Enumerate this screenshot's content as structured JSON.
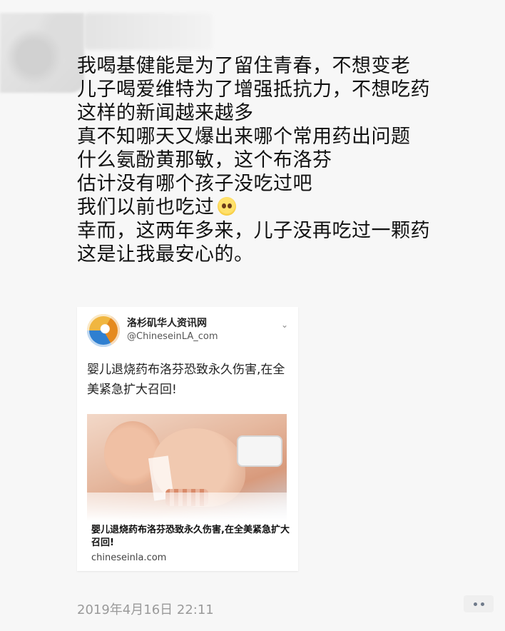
{
  "post": {
    "lines": [
      "我喝基健能是为了留住青春，不想变老",
      "儿子喝爱维特为了增强抵抗力，不想吃药",
      "这样的新闻越来越多",
      "真不知哪天又爆出来哪个常用药出问题",
      "什么氨酚黄那敏，这个布洛芬",
      "估计没有哪个孩子没吃过吧",
      "我们以前也吃过",
      "幸而，这两年多来，儿子没再吃过一颗药",
      "这是让我最安心的。"
    ],
    "emoji": "pleading-face-emoji"
  },
  "shared_card": {
    "source_name": "洛杉矶华人资讯网",
    "source_handle": "@ChineseinLA_com",
    "headline": "婴儿退烧药布洛芬恐致永久伤害,在全美紧急扩大召回!",
    "image_caption": "婴儿退烧药布洛芬恐致永久伤害,在全美紧急扩大召回!",
    "domain": "chineseinla.com"
  },
  "footer": {
    "timestamp": "2019年4月16日 22:11"
  },
  "colors": {
    "background": "#f7f7f7",
    "timestamp": "#9a9a9a",
    "more_dots": "#6f7a8a"
  }
}
